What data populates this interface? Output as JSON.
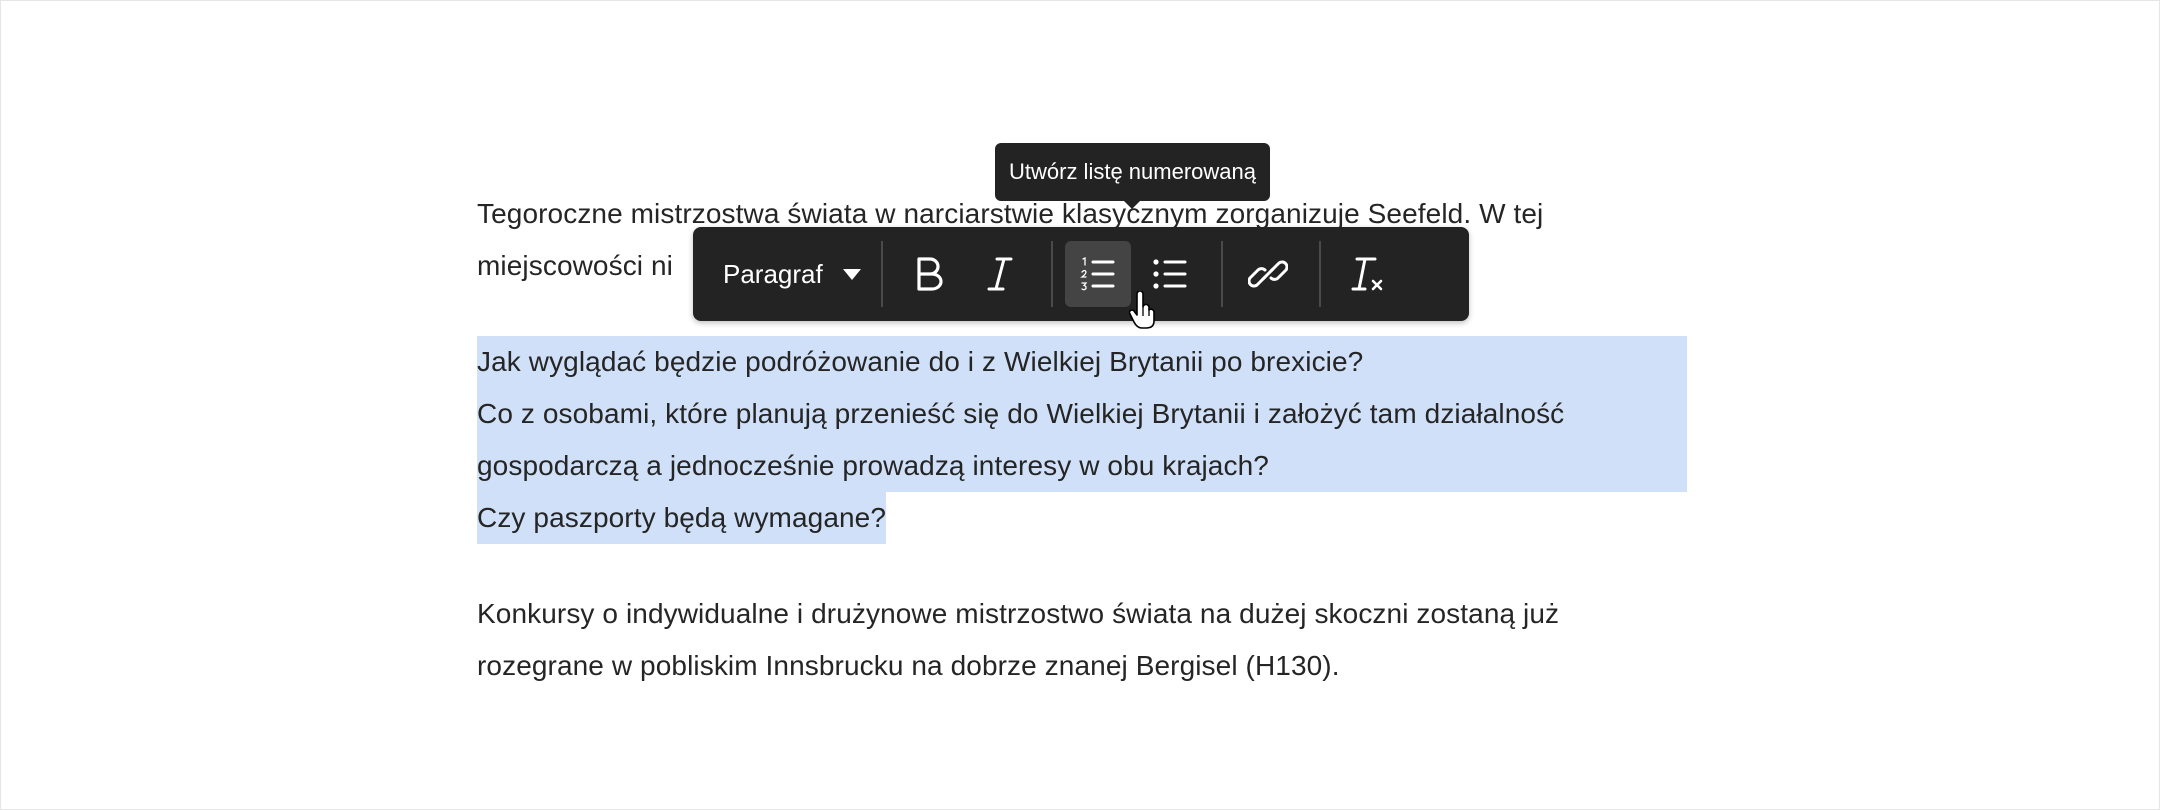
{
  "editor": {
    "para1": {
      "line1": "Tegoroczne mistrzostwa świata w narciarstwie klasycznym zorganizuje Seefeld. W tej",
      "line2": "miejscowości ni"
    },
    "selected": {
      "line1": "Jak wyglądać będzie podróżowanie do i z Wielkiej Brytanii po brexicie?",
      "line2": "Co z osobami, które planują przenieść się do Wielkiej Brytanii i założyć tam działalność",
      "line3": "gospodarczą a jednocześnie prowadzą interesy w obu krajach?",
      "line4": "Czy paszporty będą wymagane?"
    },
    "para3": {
      "line1": "Konkursy o indywidualne i drużynowe mistrzostwo świata na dużej skoczni zostaną już",
      "line2": "rozegrane w pobliskim Innsbrucku na dobrze znanej Bergisel (H130)."
    }
  },
  "toolbar": {
    "paragraph_style": "Paragraf",
    "buttons": [
      {
        "name": "bold",
        "icon": "bold-icon"
      },
      {
        "name": "italic",
        "icon": "italic-icon"
      },
      {
        "name": "numbered-list",
        "icon": "numbered-list-icon",
        "active": true
      },
      {
        "name": "bulleted-list",
        "icon": "bulleted-list-icon"
      },
      {
        "name": "link",
        "icon": "link-icon"
      },
      {
        "name": "remove-format",
        "icon": "remove-format-icon"
      }
    ]
  },
  "tooltip": {
    "text": "Utwórz listę numerowaną"
  },
  "colors": {
    "selection": "#cfe0f8",
    "toolbar_bg": "#232323",
    "text": "#252525"
  }
}
